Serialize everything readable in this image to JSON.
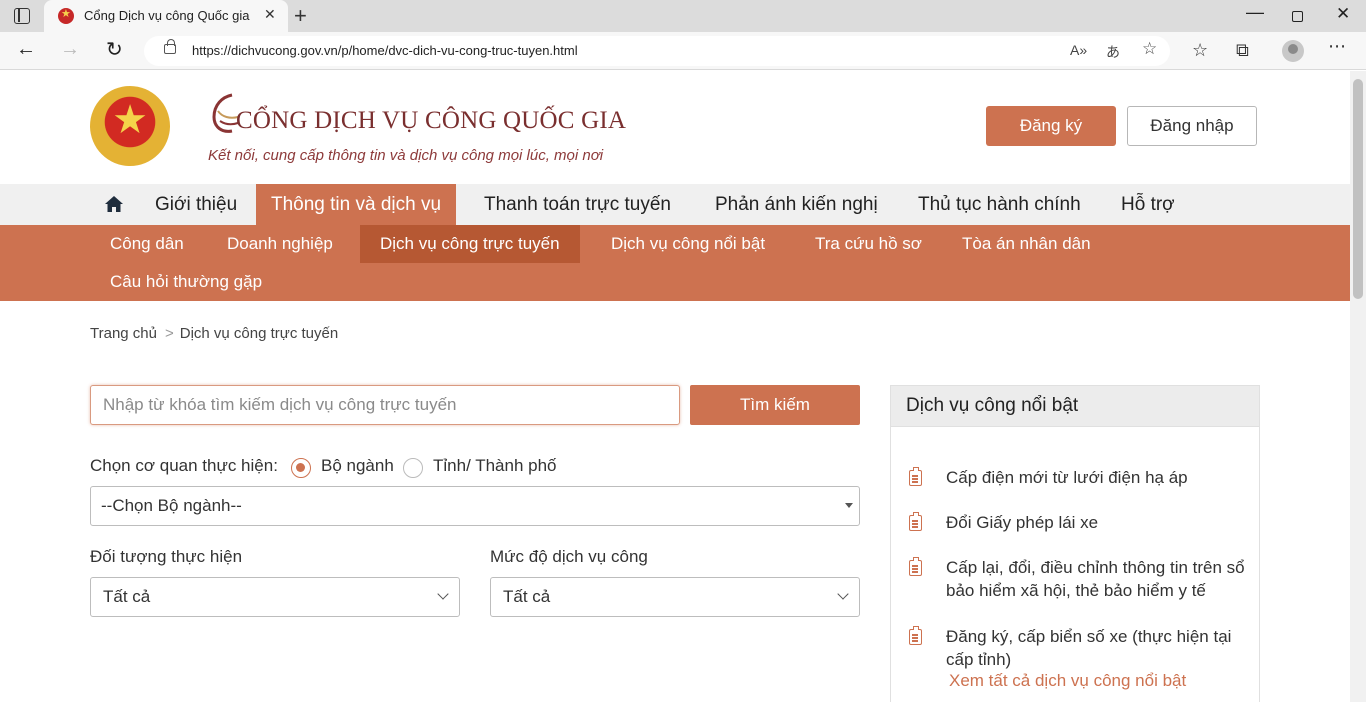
{
  "browser": {
    "tab_title": "Cổng Dịch vụ công Quốc gia",
    "url": "https://dichvucong.gov.vn/p/home/dvc-dich-vu-cong-truc-tuyen.html"
  },
  "header": {
    "title": "CỔNG DỊCH VỤ CÔNG QUỐC GIA",
    "subtitle": "Kết nối, cung cấp thông tin và dịch vụ công mọi lúc, mọi nơi",
    "register_label": "Đăng ký",
    "login_label": "Đăng nhập"
  },
  "main_nav": {
    "items": [
      {
        "label": "Giới thiệu"
      },
      {
        "label": "Thông tin và dịch vụ"
      },
      {
        "label": "Thanh toán trực tuyến"
      },
      {
        "label": "Phản ánh kiến nghị"
      },
      {
        "label": "Thủ tục hành chính"
      },
      {
        "label": "Hỗ trợ"
      }
    ],
    "active_index": 1
  },
  "sub_nav": {
    "items": [
      {
        "label": "Công dân"
      },
      {
        "label": "Doanh nghiệp"
      },
      {
        "label": "Dịch vụ công trực tuyến"
      },
      {
        "label": "Dịch vụ công nổi bật"
      },
      {
        "label": "Tra cứu hồ sơ"
      },
      {
        "label": "Tòa án nhân dân"
      },
      {
        "label": "Câu hỏi thường gặp"
      }
    ],
    "active_index": 2
  },
  "breadcrumb": {
    "home": "Trang chủ",
    "separator": ">",
    "current": "Dịch vụ công trực tuyến"
  },
  "search": {
    "placeholder": "Nhập từ khóa tìm kiếm dịch vụ công trực tuyến",
    "value": "",
    "button_label": "Tìm kiếm"
  },
  "agency": {
    "label": "Chọn cơ quan thực hiện:",
    "options": [
      "Bộ ngành",
      "Tỉnh/ Thành phố"
    ],
    "selected": "Bộ ngành",
    "select_value": "--Chọn Bộ ngành--"
  },
  "filters": {
    "target_label": "Đối tượng thực hiện",
    "target_value": "Tất cả",
    "level_label": "Mức độ dịch vụ công",
    "level_value": "Tất cả"
  },
  "featured": {
    "title": "Dịch vụ công nổi bật",
    "items": [
      "Cấp điện mới từ lưới điện hạ áp",
      "Đổi Giấy phép lái xe",
      "Cấp lại, đổi, điều chỉnh thông tin trên sổ bảo hiểm xã hội, thẻ bảo hiểm y tế",
      "Đăng ký, cấp biển số xe (thực hiện tại cấp tỉnh)"
    ],
    "see_all": "Xem tất cả dịch vụ công nổi bật"
  },
  "colors": {
    "accent": "#cd7250",
    "accent_dark": "#b65833",
    "title": "#7a2f2f"
  }
}
